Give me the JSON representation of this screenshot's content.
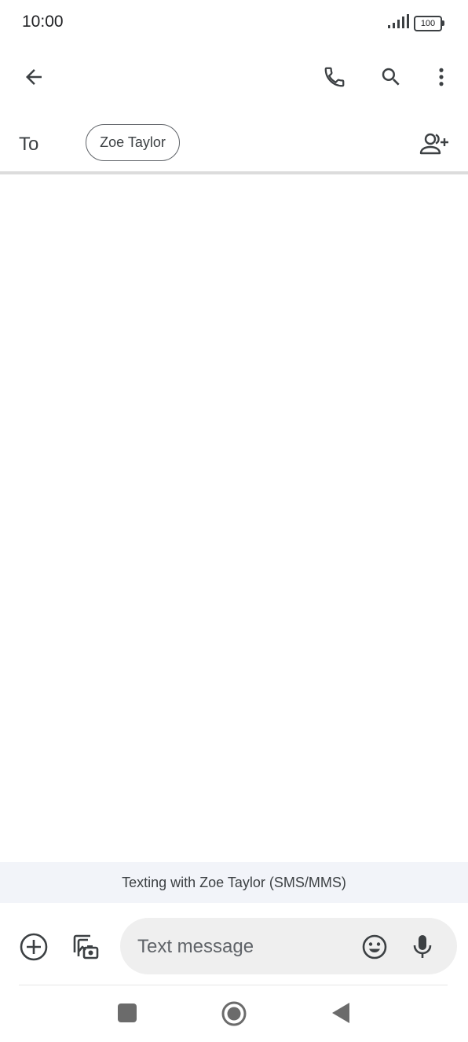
{
  "status_bar": {
    "time": "10:00",
    "battery": "100",
    "icons": [
      "signal-icon",
      "battery-icon"
    ]
  },
  "app_bar": {
    "icons": [
      "back-arrow-icon",
      "phone-icon",
      "search-icon",
      "more-vert-icon"
    ]
  },
  "recipient": {
    "to_label": "To",
    "chip_name": "Zoe Taylor",
    "add_icon": "person-add-icon"
  },
  "banner": {
    "text": "Texting with Zoe Taylor (SMS/MMS)"
  },
  "composer": {
    "placeholder": "Text message",
    "value": "",
    "icons": [
      "add-circle-icon",
      "gallery-icon",
      "emoji-icon",
      "mic-icon"
    ]
  },
  "nav_bar": {
    "icons": [
      "recents-square-icon",
      "home-circle-icon",
      "back-triangle-icon"
    ]
  },
  "colors": {
    "icon": "#3c4043",
    "banner_bg": "#f2f4f9",
    "compose_bg": "#efefef",
    "divider": "#dcdcdc"
  }
}
